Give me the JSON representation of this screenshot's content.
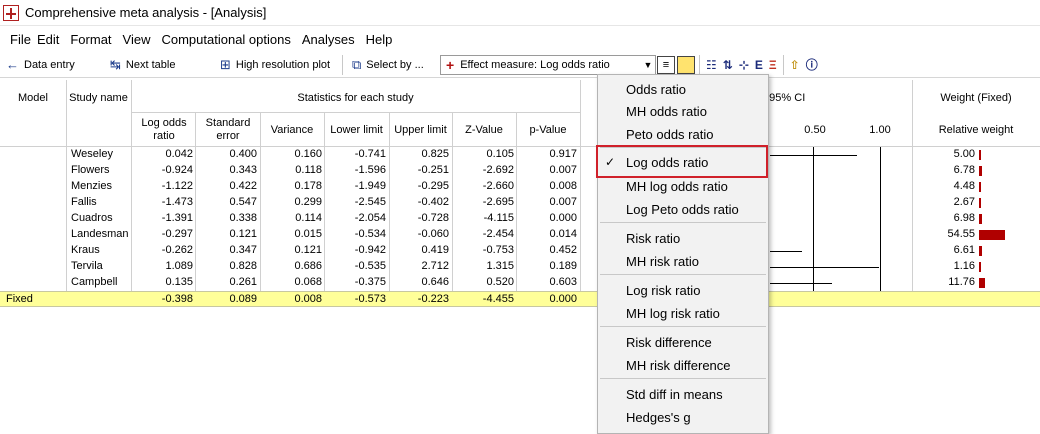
{
  "window": {
    "title": "Comprehensive meta analysis - [Analysis]"
  },
  "menu": [
    "File",
    "Edit",
    "Format",
    "View",
    "Computational options",
    "Analyses",
    "Help"
  ],
  "toolbar": {
    "data_entry": "Data entry",
    "next_table": "Next table",
    "high_res_plot": "High resolution plot",
    "select_by": "Select by ...",
    "effect_measure": "Effect measure:  Log odds ratio"
  },
  "columns": {
    "model": "Model",
    "study_name": "Study name",
    "stats_group": "Statistics for each study",
    "log_odds_ratio": "Log odds ratio",
    "standard_error": "Standard error",
    "variance": "Variance",
    "lower_limit": "Lower limit",
    "upper_limit": "Upper limit",
    "z_value": "Z-Value",
    "p_value": "p-Value",
    "ci_header": "d 95% CI",
    "axis_050": "0.50",
    "axis_100": "1.00",
    "weight_group": "Weight (Fixed)",
    "relative_weight": "Relative weight"
  },
  "rows": [
    {
      "study": "Weseley",
      "lor": "0.042",
      "se": "0.400",
      "var": "0.160",
      "ll": "-0.741",
      "ul": "0.825",
      "z": "0.105",
      "p": "0.917",
      "w": "5.00",
      "wv": 5.0
    },
    {
      "study": "Flowers",
      "lor": "-0.924",
      "se": "0.343",
      "var": "0.118",
      "ll": "-1.596",
      "ul": "-0.251",
      "z": "-2.692",
      "p": "0.007",
      "w": "6.78",
      "wv": 6.78
    },
    {
      "study": "Menzies",
      "lor": "-1.122",
      "se": "0.422",
      "var": "0.178",
      "ll": "-1.949",
      "ul": "-0.295",
      "z": "-2.660",
      "p": "0.008",
      "w": "4.48",
      "wv": 4.48
    },
    {
      "study": "Fallis",
      "lor": "-1.473",
      "se": "0.547",
      "var": "0.299",
      "ll": "-2.545",
      "ul": "-0.402",
      "z": "-2.695",
      "p": "0.007",
      "w": "2.67",
      "wv": 2.67
    },
    {
      "study": "Cuadros",
      "lor": "-1.391",
      "se": "0.338",
      "var": "0.114",
      "ll": "-2.054",
      "ul": "-0.728",
      "z": "-4.115",
      "p": "0.000",
      "w": "6.98",
      "wv": 6.98
    },
    {
      "study": "Landesman",
      "lor": "-0.297",
      "se": "0.121",
      "var": "0.015",
      "ll": "-0.534",
      "ul": "-0.060",
      "z": "-2.454",
      "p": "0.014",
      "w": "54.55",
      "wv": 54.55
    },
    {
      "study": "Kraus",
      "lor": "-0.262",
      "se": "0.347",
      "var": "0.121",
      "ll": "-0.942",
      "ul": "0.419",
      "z": "-0.753",
      "p": "0.452",
      "w": "6.61",
      "wv": 6.61
    },
    {
      "study": "Tervila",
      "lor": "1.089",
      "se": "0.828",
      "var": "0.686",
      "ll": "-0.535",
      "ul": "2.712",
      "z": "1.315",
      "p": "0.189",
      "w": "1.16",
      "wv": 1.16
    },
    {
      "study": "Campbell",
      "lor": "0.135",
      "se": "0.261",
      "var": "0.068",
      "ll": "-0.375",
      "ul": "0.646",
      "z": "0.520",
      "p": "0.603",
      "w": "11.76",
      "wv": 11.76
    }
  ],
  "fixed": {
    "model": "Fixed",
    "lor": "-0.398",
    "se": "0.089",
    "var": "0.008",
    "ll": "-0.573",
    "ul": "-0.223",
    "z": "-4.455",
    "p": "0.000"
  },
  "dropdown": {
    "items": [
      "Odds ratio",
      "MH odds ratio",
      "Peto odds ratio",
      "Log odds ratio",
      "MH log odds ratio",
      "Log Peto odds ratio",
      "Risk ratio",
      "MH risk ratio",
      "Log risk ratio",
      "MH log risk ratio",
      "Risk difference",
      "MH risk difference",
      "Std diff in means",
      "Hedges's g"
    ],
    "selected": "Log odds ratio",
    "check_glyph": "✓"
  },
  "colors": {
    "fixed_row": "#ffff99",
    "weight_bar": "#b00000",
    "highlight": "#d0202a"
  }
}
